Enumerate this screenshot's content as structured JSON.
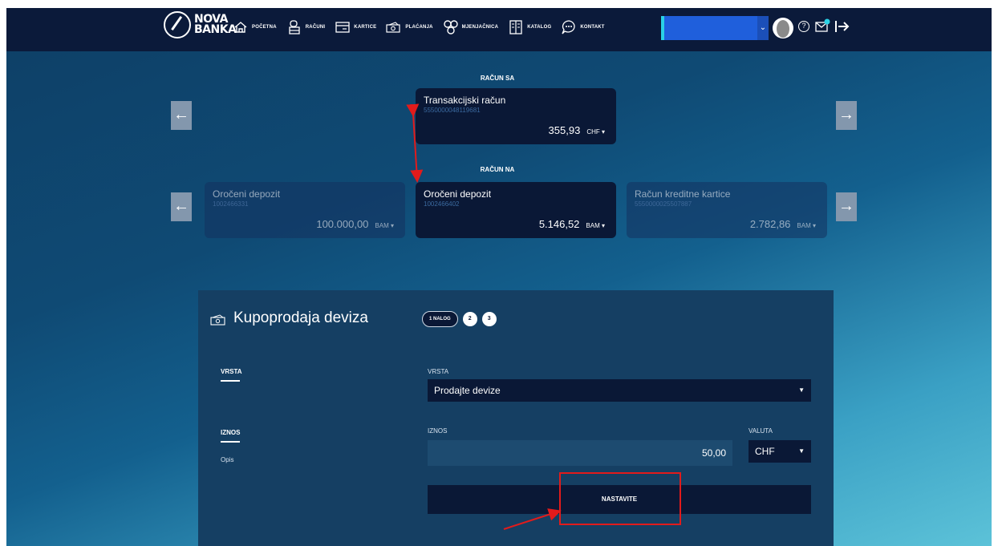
{
  "nav": {
    "logo_line1": "NOVA",
    "logo_line2": "BANKA",
    "items": [
      {
        "label": "POČETNA",
        "icon": "home-icon"
      },
      {
        "label": "RAČUNI",
        "icon": "wallet-icon"
      },
      {
        "label": "KARTICE",
        "icon": "card-icon"
      },
      {
        "label": "PLAĆANJA",
        "icon": "cash-icon"
      },
      {
        "label": "MJENJAČNICA",
        "icon": "exchange-icon"
      },
      {
        "label": "KATALOG",
        "icon": "catalog-icon"
      },
      {
        "label": "KONTAKT",
        "icon": "chat-icon"
      }
    ],
    "account_select_value": "",
    "help_symbol": "?"
  },
  "accounts": {
    "from_label": "RAČUN SA",
    "to_label": "RAČUN NA",
    "from_card": {
      "name": "Transakcijski račun",
      "number": "5550000048119681",
      "amount": "355,93",
      "currency": "CHF ▾"
    },
    "to_cards": [
      {
        "name": "Oročeni depozit",
        "number": "1002466331",
        "amount": "100.000,00",
        "currency": "BAM ▾"
      },
      {
        "name": "Oročeni depozit",
        "number": "1002466402",
        "amount": "5.146,52",
        "currency": "BAM ▾"
      },
      {
        "name": "Račun kreditne kartice",
        "number": "5550000025507887",
        "amount": "2.782,86",
        "currency": "BAM ▾"
      }
    ],
    "arrow_left": "←",
    "arrow_right": "→"
  },
  "form": {
    "title": "Kupoprodaja deviza",
    "steps": {
      "active": "1 NALOG",
      "step2": "2",
      "step3": "3"
    },
    "side": {
      "vrsta": "VRSTA",
      "iznos": "IZNOS",
      "opis": "Opis"
    },
    "vrsta_label": "VRSTA",
    "vrsta_value": "Prodajte devize",
    "iznos_label": "IZNOS",
    "iznos_value": "50,00",
    "valuta_label": "VALUTA",
    "valuta_value": "CHF",
    "continue_label": "NASTAVITE"
  },
  "colors": {
    "nav_bg": "#0b1a3a",
    "card_bg": "#0a1836",
    "annotation": "#e21b1b",
    "accent_select": "#1f5fdc"
  }
}
